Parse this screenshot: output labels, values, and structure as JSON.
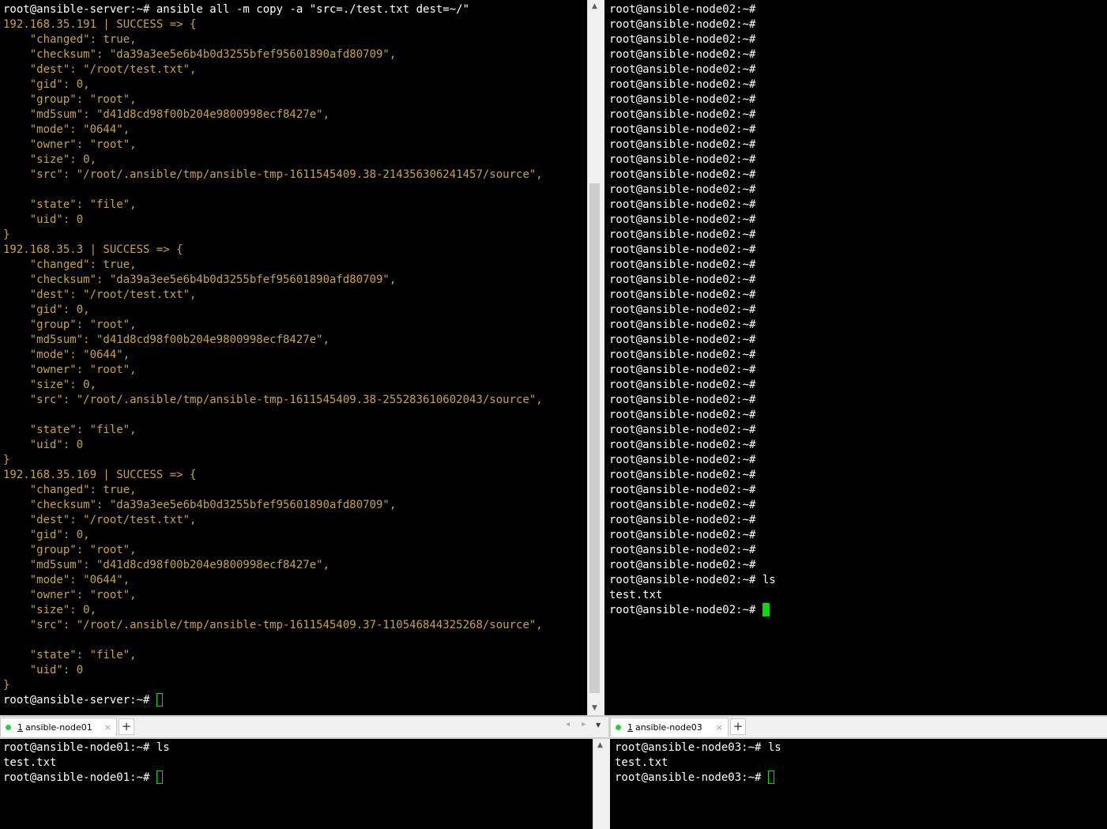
{
  "panes": {
    "server": {
      "tab": "",
      "lines": [
        {
          "t": "root@ansible-server:~# ansible all -m copy -a \"src=./test.txt dest=~/\"",
          "c": "w"
        },
        {
          "t": "192.168.35.191 | SUCCESS => {",
          "c": "y"
        },
        {
          "t": "    \"changed\": true,",
          "c": "y"
        },
        {
          "t": "    \"checksum\": \"da39a3ee5e6b4b0d3255bfef95601890afd80709\",",
          "c": "y"
        },
        {
          "t": "    \"dest\": \"/root/test.txt\",",
          "c": "y"
        },
        {
          "t": "    \"gid\": 0,",
          "c": "y"
        },
        {
          "t": "    \"group\": \"root\",",
          "c": "y"
        },
        {
          "t": "    \"md5sum\": \"d41d8cd98f00b204e9800998ecf8427e\",",
          "c": "y"
        },
        {
          "t": "    \"mode\": \"0644\",",
          "c": "y"
        },
        {
          "t": "    \"owner\": \"root\",",
          "c": "y"
        },
        {
          "t": "    \"size\": 0,",
          "c": "y"
        },
        {
          "t": "    \"src\": \"/root/.ansible/tmp/ansible-tmp-1611545409.38-214356306241457/source\",",
          "c": "y"
        },
        {
          "t": "",
          "c": "y"
        },
        {
          "t": "    \"state\": \"file\",",
          "c": "y"
        },
        {
          "t": "    \"uid\": 0",
          "c": "y"
        },
        {
          "t": "}",
          "c": "y"
        },
        {
          "t": "192.168.35.3 | SUCCESS => {",
          "c": "y"
        },
        {
          "t": "    \"changed\": true,",
          "c": "y"
        },
        {
          "t": "    \"checksum\": \"da39a3ee5e6b4b0d3255bfef95601890afd80709\",",
          "c": "y"
        },
        {
          "t": "    \"dest\": \"/root/test.txt\",",
          "c": "y"
        },
        {
          "t": "    \"gid\": 0,",
          "c": "y"
        },
        {
          "t": "    \"group\": \"root\",",
          "c": "y"
        },
        {
          "t": "    \"md5sum\": \"d41d8cd98f00b204e9800998ecf8427e\",",
          "c": "y"
        },
        {
          "t": "    \"mode\": \"0644\",",
          "c": "y"
        },
        {
          "t": "    \"owner\": \"root\",",
          "c": "y"
        },
        {
          "t": "    \"size\": 0,",
          "c": "y"
        },
        {
          "t": "    \"src\": \"/root/.ansible/tmp/ansible-tmp-1611545409.38-255283610602043/source\",",
          "c": "y"
        },
        {
          "t": "",
          "c": "y"
        },
        {
          "t": "    \"state\": \"file\",",
          "c": "y"
        },
        {
          "t": "    \"uid\": 0",
          "c": "y"
        },
        {
          "t": "}",
          "c": "y"
        },
        {
          "t": "192.168.35.169 | SUCCESS => {",
          "c": "y"
        },
        {
          "t": "    \"changed\": true,",
          "c": "y"
        },
        {
          "t": "    \"checksum\": \"da39a3ee5e6b4b0d3255bfef95601890afd80709\",",
          "c": "y"
        },
        {
          "t": "    \"dest\": \"/root/test.txt\",",
          "c": "y"
        },
        {
          "t": "    \"gid\": 0,",
          "c": "y"
        },
        {
          "t": "    \"group\": \"root\",",
          "c": "y"
        },
        {
          "t": "    \"md5sum\": \"d41d8cd98f00b204e9800998ecf8427e\",",
          "c": "y"
        },
        {
          "t": "    \"mode\": \"0644\",",
          "c": "y"
        },
        {
          "t": "    \"owner\": \"root\",",
          "c": "y"
        },
        {
          "t": "    \"size\": 0,",
          "c": "y"
        },
        {
          "t": "    \"src\": \"/root/.ansible/tmp/ansible-tmp-1611545409.37-110546844325268/source\",",
          "c": "y"
        },
        {
          "t": "",
          "c": "y"
        },
        {
          "t": "    \"state\": \"file\",",
          "c": "y"
        },
        {
          "t": "    \"uid\": 0",
          "c": "y"
        },
        {
          "t": "}",
          "c": "y"
        }
      ],
      "prompt": "root@ansible-server:~# "
    },
    "node02": {
      "empty_prompt": "root@ansible-node02:~#",
      "empty_prompt_count": 38,
      "lines": [
        {
          "t": "root@ansible-node02:~# ls",
          "c": "w"
        },
        {
          "t": "test.txt",
          "c": "w"
        }
      ],
      "prompt": "root@ansible-node02:~# "
    },
    "node01": {
      "tab": {
        "index": "1",
        "name": "ansible-node01",
        "close": "×"
      },
      "lines": [
        {
          "t": "root@ansible-node01:~# ls",
          "c": "w"
        },
        {
          "t": "test.txt",
          "c": "w"
        }
      ],
      "prompt": "root@ansible-node01:~# "
    },
    "node03": {
      "tab": {
        "index": "1",
        "name": "ansible-node03",
        "close": "×"
      },
      "lines": [
        {
          "t": "root@ansible-node03:~# ls",
          "c": "w"
        },
        {
          "t": "test.txt",
          "c": "w"
        }
      ],
      "prompt": "root@ansible-node03:~# "
    }
  },
  "tabbar": {
    "add": "+",
    "arrows": "◂ ▸",
    "dropdown": "▼"
  },
  "scroll": {
    "up": "▲",
    "down": "▼"
  },
  "colors": {
    "output": "#c8a53c",
    "text": "#ffffff",
    "cursor": "#00e000",
    "background": "#000000"
  }
}
